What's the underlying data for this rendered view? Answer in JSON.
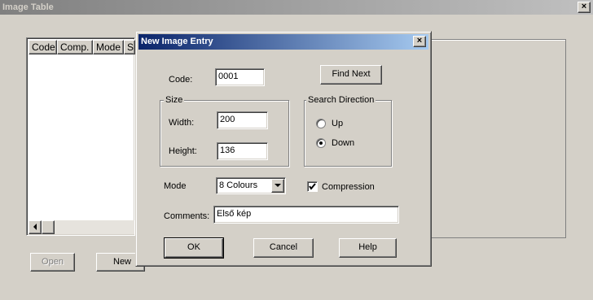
{
  "main_window": {
    "title": "Image Table",
    "close_label": "×"
  },
  "listview": {
    "columns": [
      "Code",
      "Comp.",
      "Mode",
      "S"
    ]
  },
  "main_buttons": {
    "open_label": "Open",
    "new_label": "New"
  },
  "dialog": {
    "title": "New Image Entry",
    "close_label": "×",
    "code_label": "Code:",
    "code_value": "0001",
    "find_next_label": "Find Next",
    "size_group_label": "Size",
    "width_label": "Width:",
    "width_value": "200",
    "height_label": "Height:",
    "height_value": "136",
    "search_direction_label": "Search Direction",
    "search_options": [
      {
        "label": "Up",
        "selected": false
      },
      {
        "label": "Down",
        "selected": true
      }
    ],
    "mode_label": "Mode",
    "mode_value": "8 Colours",
    "compression_label": "Compression",
    "compression_checked": true,
    "comments_label": "Comments:",
    "comments_value": "Első kép",
    "ok_label": "OK",
    "cancel_label": "Cancel",
    "help_label": "Help"
  },
  "icons": {
    "scroll_left": "scroll-left-icon",
    "dropdown_arrow": "chevron-down-icon",
    "checkmark": "checkmark-icon"
  }
}
